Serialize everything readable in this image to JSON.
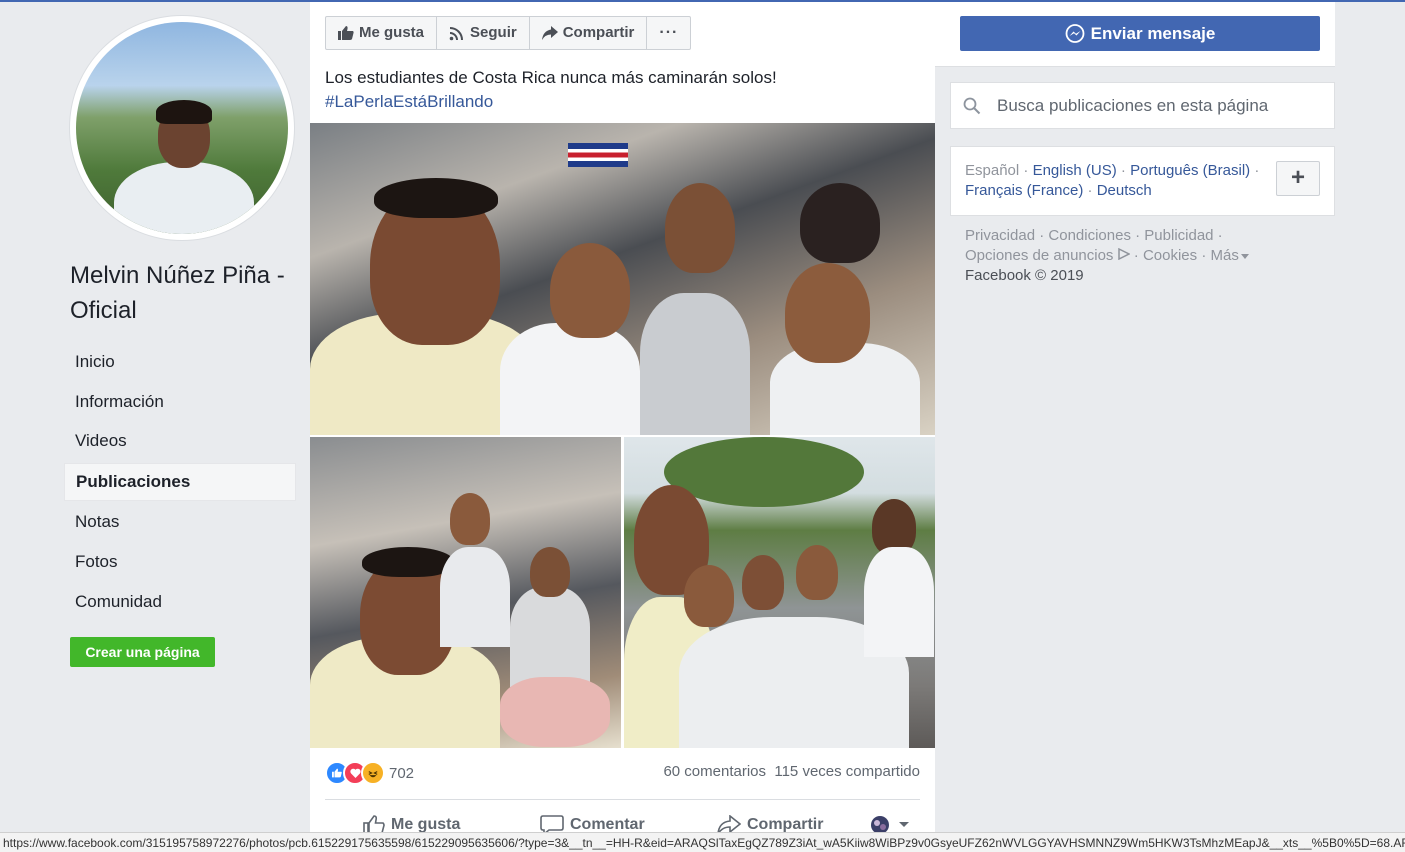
{
  "page": {
    "name": "Melvin Núñez Piña - Oficial",
    "create_page_label": "Crear una página"
  },
  "nav": {
    "items": [
      {
        "label": "Inicio",
        "active": false
      },
      {
        "label": "Información",
        "active": false
      },
      {
        "label": "Videos",
        "active": false
      },
      {
        "label": "Publicaciones",
        "active": true
      },
      {
        "label": "Notas",
        "active": false
      },
      {
        "label": "Fotos",
        "active": false
      },
      {
        "label": "Comunidad",
        "active": false
      }
    ]
  },
  "header": {
    "like_label": "Me gusta",
    "follow_label": "Seguir",
    "share_label": "Compartir",
    "more_label": "···",
    "message_label": "Enviar mensaje"
  },
  "post": {
    "text": "Los estudiantes de Costa Rica nunca más caminarán solos!",
    "hashtag": "#LaPerlaEstáBrillando",
    "reactions": [
      "like",
      "love",
      "haha"
    ],
    "reaction_count": "702",
    "comments": "60 comentarios",
    "shares": "115 veces compartido",
    "like_action": "Me gusta",
    "comment_action": "Comentar",
    "share_action": "Compartir"
  },
  "sidebar": {
    "search_placeholder": "Busca publicaciones en esta página",
    "languages": {
      "current": "Español",
      "others": [
        "English (US)",
        "Português (Brasil)",
        "Français (France)",
        "Deutsch"
      ],
      "add_label": "+"
    },
    "footer": {
      "privacy": "Privacidad",
      "terms": "Condiciones",
      "ads": "Publicidad",
      "ad_choices": "Opciones de anuncios",
      "cookies": "Cookies",
      "more": "Más",
      "copyright": "Facebook © 2019"
    }
  },
  "status_url": "https://www.facebook.com/315195758972276/photos/pcb.615229175635598/615229095635606/?type=3&__tn__=HH-R&eid=ARAQSlTaxEgQZ789Z3iAt_wA5Kiiw8WiBPz9v0GsyeUFZ62nWVLGGYAVHSMNNZ9Wm5HKW3TsMhzMEapJ&__xts__%5B0%5D=68.ARBDv_ss",
  "colors": {
    "brand_blue": "#4267b2",
    "link_blue": "#365899",
    "green": "#42b72a",
    "background": "#e9ebee"
  },
  "icons": [
    "thumbs-up-icon",
    "rss-icon",
    "share-arrow-icon",
    "more-dots-icon",
    "messenger-icon",
    "search-icon",
    "comment-icon",
    "globe-avatar-icon",
    "chevron-down-icon"
  ]
}
